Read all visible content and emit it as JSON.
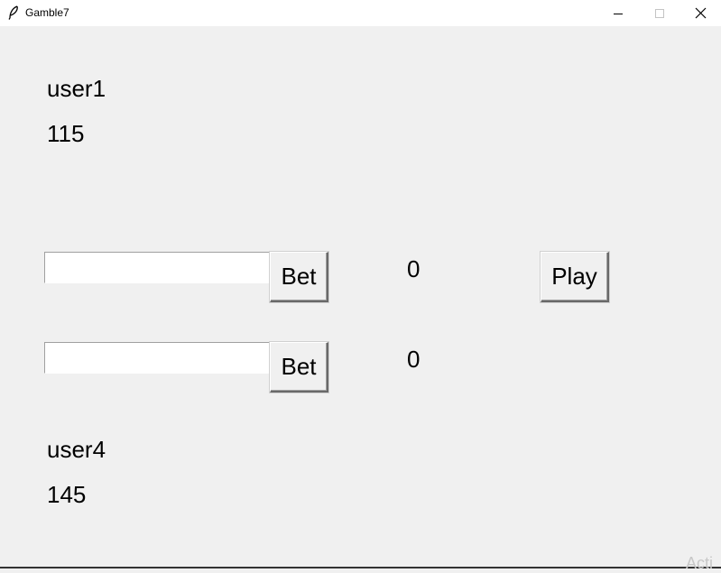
{
  "window": {
    "title": "Gamble7",
    "icon": "feather-icon",
    "controls": [
      "minimize-icon",
      "maximize-icon",
      "close-icon"
    ]
  },
  "player1": {
    "name": "user1",
    "balance": "115"
  },
  "player2": {
    "name": "user4",
    "balance": "145"
  },
  "bet_rows": [
    {
      "input_value": "",
      "button_label": "Bet",
      "amount": "0"
    },
    {
      "input_value": "",
      "button_label": "Bet",
      "amount": "0"
    }
  ],
  "play_button_label": "Play",
  "watermark": "Acti"
}
